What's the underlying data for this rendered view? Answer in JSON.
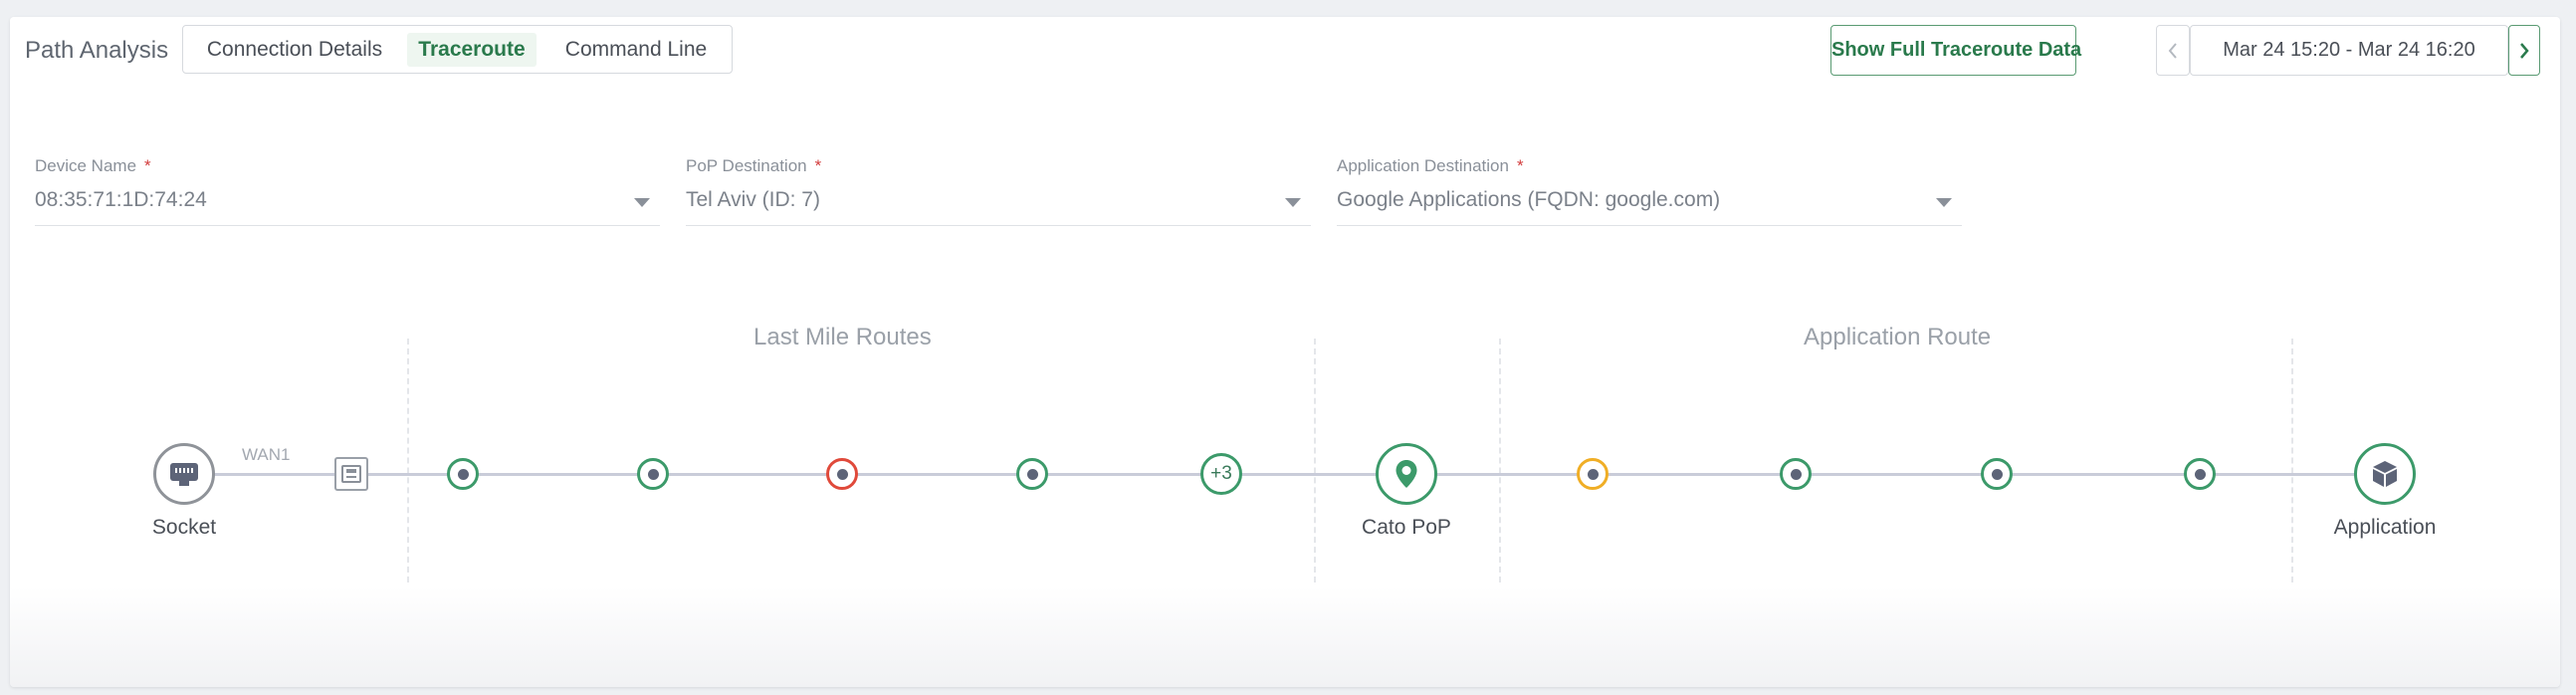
{
  "header": {
    "title": "Path Analysis",
    "tabs": [
      {
        "label": "Connection Details"
      },
      {
        "label": "Traceroute"
      },
      {
        "label": "Command Line"
      }
    ],
    "active_tab": "Traceroute",
    "full_data_button": "Show Full Traceroute Data",
    "date_range": "Mar 24 15:20 - Mar 24 16:20"
  },
  "filters": {
    "device": {
      "label": "Device Name",
      "required_mark": "*",
      "value": "08:35:71:1D:74:24"
    },
    "pop": {
      "label": "PoP Destination",
      "required_mark": "*",
      "value": "Tel Aviv (ID: 7)"
    },
    "application": {
      "label": "Application Destination",
      "required_mark": "*",
      "value": "Google Applications (FQDN: google.com)"
    }
  },
  "diagram": {
    "sections": {
      "last_mile": "Last Mile Routes",
      "application_route": "Application Route"
    },
    "socket_label": "Socket",
    "wan_label": "WAN1",
    "more_hops_label": "+3",
    "pop_label": "Cato PoP",
    "app_label": "Application",
    "colors": {
      "ok": "#3c9a6a",
      "error": "#e04a3b",
      "warning": "#f0ae26",
      "line": "#c9ccd9"
    },
    "last_mile_hops": [
      "ok",
      "ok",
      "error",
      "ok"
    ],
    "application_hops": [
      "warning",
      "ok",
      "ok",
      "ok"
    ],
    "icons": {
      "socket": "ethernet-port-icon",
      "router": "router-device-icon",
      "pop": "map-pin-icon",
      "application": "cube-icon"
    }
  }
}
